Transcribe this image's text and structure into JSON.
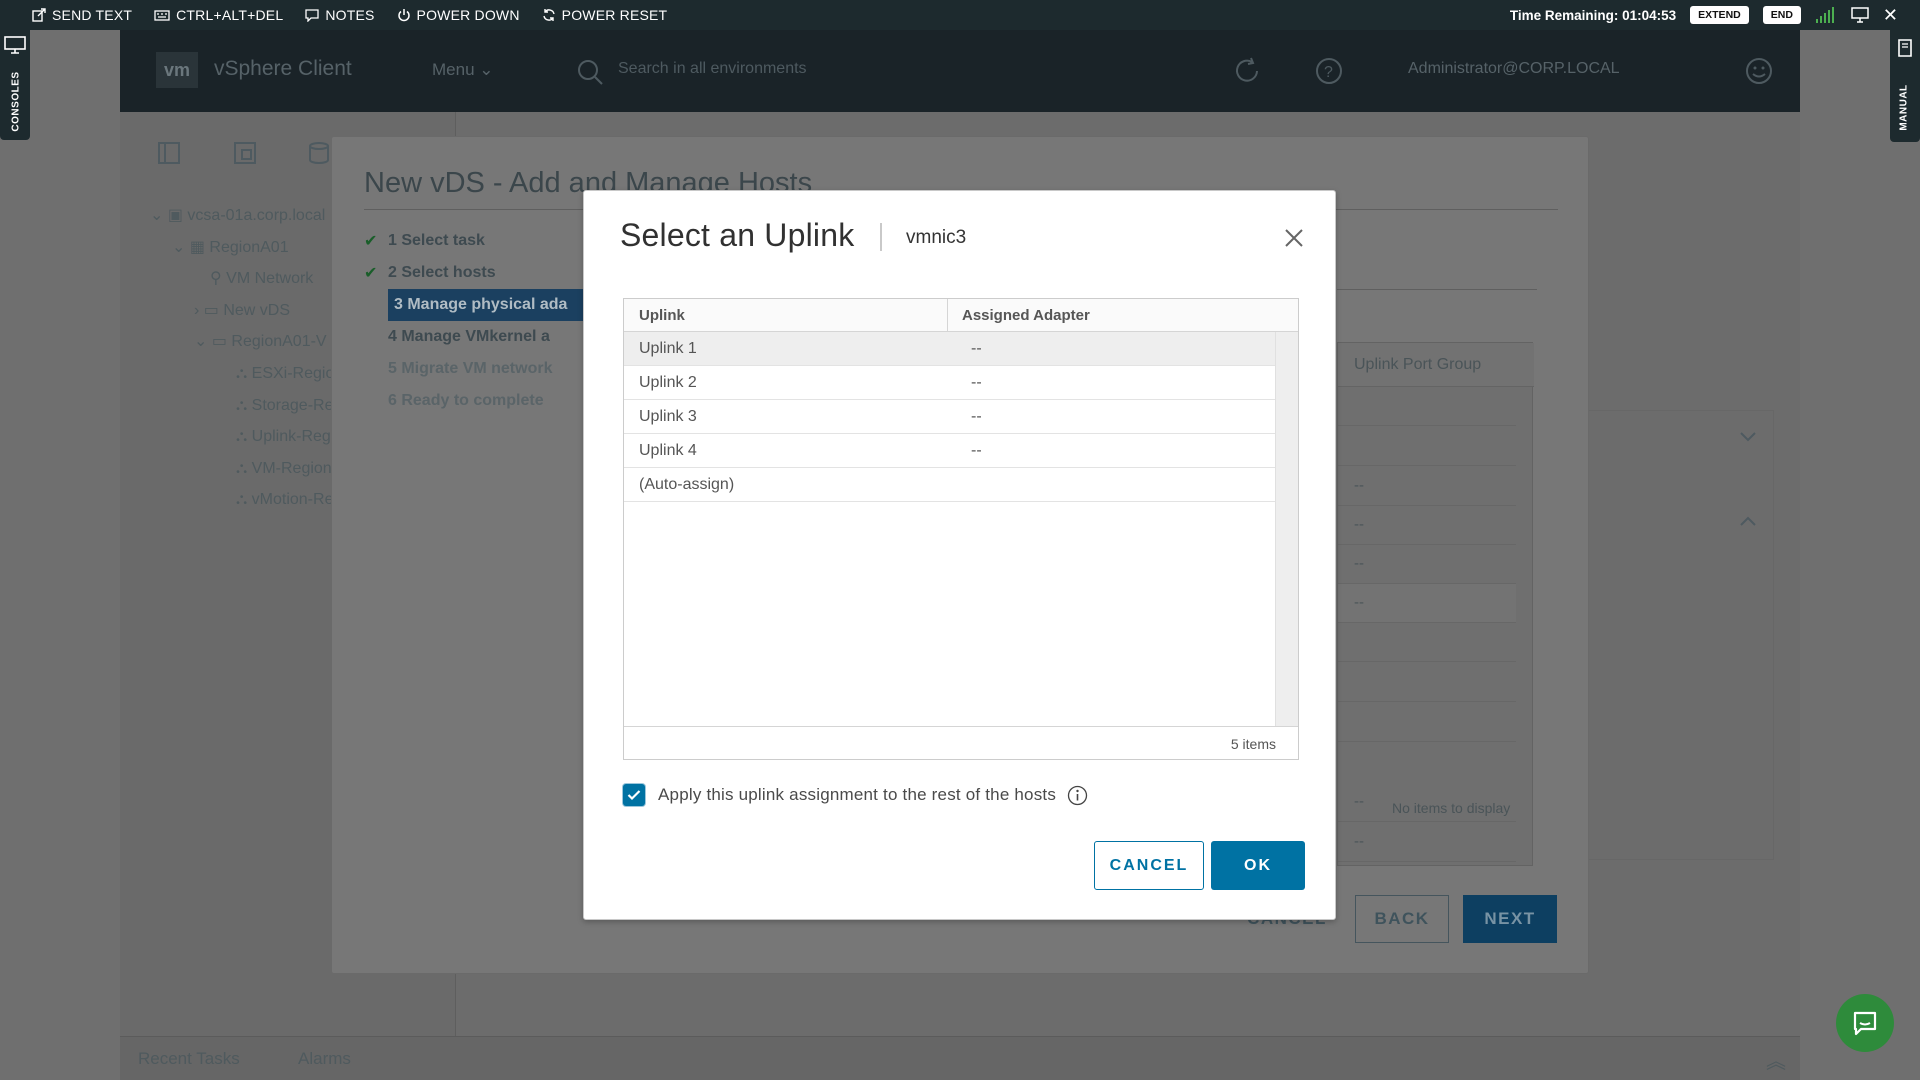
{
  "toolbar": {
    "actions": [
      {
        "label": "SEND TEXT",
        "icon": "send-text-icon"
      },
      {
        "label": "CTRL+ALT+DEL",
        "icon": "keyboard-icon"
      },
      {
        "label": "NOTES",
        "icon": "notes-icon"
      },
      {
        "label": "POWER DOWN",
        "icon": "power-icon"
      },
      {
        "label": "POWER RESET",
        "icon": "reset-icon"
      }
    ],
    "time_remaining": "Time Remaining: 01:04:53",
    "extend_label": "EXTEND",
    "end_label": "END"
  },
  "side_tabs": {
    "left": "CONSOLES",
    "right": "MANUAL"
  },
  "vsphere": {
    "logo": "vm",
    "app_title": "vSphere Client",
    "menu_label": "Menu",
    "search_placeholder": "Search in all environments",
    "user": "Administrator@CORP.LOCAL",
    "tree": [
      "vcsa-01a.corp.local",
      "RegionA01",
      "VM Network",
      "New vDS",
      "RegionA01-V",
      "ESXi-Regio",
      "Storage-Re",
      "Uplink-Reg",
      "VM-Region",
      "vMotion-Re"
    ],
    "recent_tasks": "Recent Tasks",
    "alarms": "Alarms"
  },
  "wizard": {
    "title": "New vDS - Add and Manage Hosts",
    "steps": [
      {
        "label": "1 Select task",
        "state": "done"
      },
      {
        "label": "2 Select hosts",
        "state": "done"
      },
      {
        "label": "3 Manage physical ada",
        "state": "active"
      },
      {
        "label": "4 Manage VMkernel a",
        "state": "todo"
      },
      {
        "label": "5 Migrate VM network",
        "state": "disabled"
      },
      {
        "label": "6 Ready to complete",
        "state": "disabled"
      }
    ],
    "panel_header": "Uplink Port Group",
    "panel_values": [
      "--",
      "--",
      "--",
      "--",
      "--",
      "--"
    ],
    "no_items": "No items to display",
    "cancel_label": "CANCEL",
    "back_label": "BACK",
    "next_label": "NEXT"
  },
  "dialog": {
    "title": "Select an Uplink",
    "subtitle": "vmnic3",
    "columns": [
      "Uplink",
      "Assigned Adapter"
    ],
    "rows": [
      {
        "uplink": "Uplink 1",
        "adapter": "--",
        "selected": true
      },
      {
        "uplink": "Uplink 2",
        "adapter": "--",
        "selected": false
      },
      {
        "uplink": "Uplink 3",
        "adapter": "--",
        "selected": false
      },
      {
        "uplink": "Uplink 4",
        "adapter": "--",
        "selected": false
      },
      {
        "uplink": "(Auto-assign)",
        "adapter": "",
        "selected": false
      }
    ],
    "footer": "5 items",
    "apply_label": "Apply this uplink assignment to the rest of the hosts",
    "apply_checked": true,
    "cancel_label": "CANCEL",
    "ok_label": "OK"
  },
  "colors": {
    "primary": "#0072a3",
    "toolbar_bg": "#1d2a2e",
    "chat": "#2e8b3b"
  }
}
